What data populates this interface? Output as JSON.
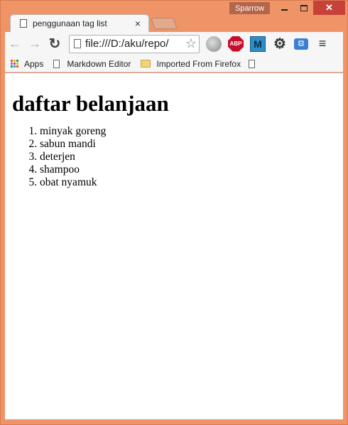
{
  "window": {
    "profile_name": "Sparrow",
    "min_icon": "minimize-icon",
    "max_icon": "maximize-icon",
    "close_icon": "close-icon"
  },
  "tabs": [
    {
      "title": "penggunaan tag list",
      "close": "×",
      "active": true
    }
  ],
  "toolbar": {
    "back": "←",
    "forward": "→",
    "reload": "↻",
    "url": "file:///D:/aku/repo/",
    "star": "☆",
    "abp": "ABP",
    "m_ext": "M",
    "gear": "⚙",
    "tag_ext": "⊡",
    "menu": "≡"
  },
  "bookmarks": {
    "apps": "Apps",
    "items": [
      {
        "label": "Markdown Editor",
        "type": "page"
      },
      {
        "label": "Imported From Firefox",
        "type": "folder"
      }
    ]
  },
  "page": {
    "heading": "daftar belanjaan",
    "list": [
      "minyak goreng",
      "sabun mandi",
      "deterjen",
      "shampoo",
      "obat nyamuk"
    ]
  },
  "colors": {
    "frame": "#ef9467",
    "close_button": "#c7413b",
    "profile_chip": "#b5654a"
  }
}
